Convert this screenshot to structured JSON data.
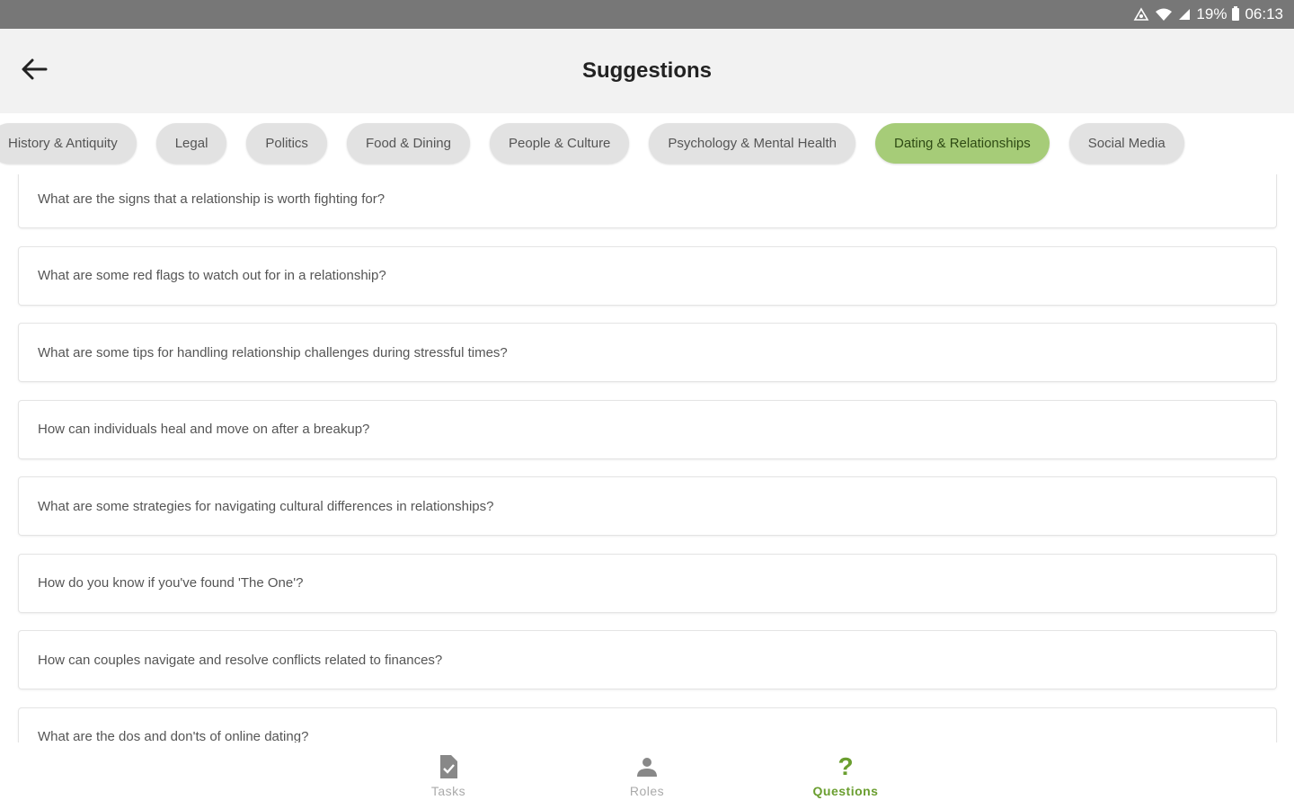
{
  "status_bar": {
    "battery": "19%",
    "time": "06:13",
    "icons": [
      "alarm-icon",
      "wifi-icon",
      "signal-icon",
      "battery-icon"
    ]
  },
  "app_bar": {
    "title": "Suggestions",
    "back_icon": "arrow-left-icon"
  },
  "categories": [
    {
      "label": ""
    },
    {
      "label": "History & Antiquity"
    },
    {
      "label": "Legal"
    },
    {
      "label": "Politics"
    },
    {
      "label": "Food & Dining"
    },
    {
      "label": "People & Culture"
    },
    {
      "label": "Psychology & Mental Health"
    },
    {
      "label": "Dating & Relationships"
    },
    {
      "label": "Social Media"
    }
  ],
  "selected_category": "Dating & Relationships",
  "questions": [
    "What are the signs that a relationship is worth fighting for?",
    "What are some red flags to watch out for in a relationship?",
    "What are some tips for handling relationship challenges during stressful times?",
    "How can individuals heal and move on after a breakup?",
    "What are some strategies for navigating cultural differences in relationships?",
    "How do you know if you've found 'The One'?",
    "How can couples navigate and resolve conflicts related to finances?",
    "What are the dos and don'ts of online dating?"
  ],
  "bottom_nav": {
    "items": [
      {
        "label": "Tasks",
        "icon": "task-document-icon"
      },
      {
        "label": "Roles",
        "icon": "person-icon"
      },
      {
        "label": "Questions",
        "icon": "question-mark-icon"
      }
    ],
    "active": "Questions"
  },
  "colors": {
    "accent": "#6a9e2f",
    "selected_chip": "#a6cc78",
    "chip": "#e2e2e2",
    "status_bar": "#777777",
    "app_bar": "#f2f2f2"
  }
}
